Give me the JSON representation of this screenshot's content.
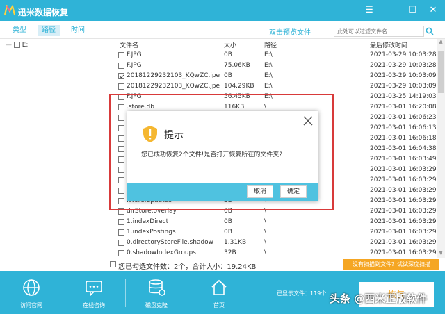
{
  "app": {
    "title": "迅米数据恢复"
  },
  "window_controls": {
    "menu": "☰",
    "minimize": "—",
    "maximize": "☐",
    "close": "✕"
  },
  "tabs": [
    {
      "label": "类型"
    },
    {
      "label": "路径"
    },
    {
      "label": "时间"
    }
  ],
  "toolbar": {
    "preview_link": "双击预览文件",
    "search_placeholder": "此处可以过滤文件名"
  },
  "tree": {
    "root_label": "E:"
  },
  "table": {
    "headers": {
      "name": "文件名",
      "size": "大小",
      "path": "路径",
      "mtime": "最后修改时间"
    },
    "rows": [
      {
        "checked": false,
        "name": "F.JPG",
        "size": "0B",
        "path": "E:\\",
        "mtime": "2021-03-29 10:03:28"
      },
      {
        "checked": false,
        "name": "F.JPG",
        "size": "75.06KB",
        "path": "E:\\",
        "mtime": "2021-03-29 10:03:28"
      },
      {
        "checked": true,
        "name": "20181229232103_KQwZC.jpeg",
        "size": "0B",
        "path": "E:\\",
        "mtime": "2021-03-29 10:03:09"
      },
      {
        "checked": false,
        "name": "20181229232103_KQwZC.jpeg",
        "size": "104.29KB",
        "path": "E:\\",
        "mtime": "2021-03-29 10:03:09"
      },
      {
        "checked": false,
        "name": "F.JPG",
        "size": "56.45KB",
        "path": "E:\\",
        "mtime": "2021-03-25 14:19:03"
      },
      {
        "checked": false,
        "name": ".store.db",
        "size": "116KB",
        "path": "\\",
        "mtime": "2021-03-01 16:20:08"
      },
      {
        "checked": false,
        "name": "",
        "size": "",
        "path": "",
        "mtime": "2021-03-01 16:06:23"
      },
      {
        "checked": false,
        "name": "",
        "size": "",
        "path": "",
        "mtime": "2021-03-01 16:06:13"
      },
      {
        "checked": false,
        "name": "",
        "size": "",
        "path": "",
        "mtime": "2021-03-01 16:06:18"
      },
      {
        "checked": false,
        "name": "",
        "size": "",
        "path": "",
        "mtime": "2021-03-01 16:04:38"
      },
      {
        "checked": false,
        "name": "",
        "size": "",
        "path": "",
        "mtime": "2021-03-01 16:03:49"
      },
      {
        "checked": false,
        "name": "",
        "size": "",
        "path": "",
        "mtime": "2021-03-01 16:03:29"
      },
      {
        "checked": false,
        "name": "",
        "size": "",
        "path": "",
        "mtime": "2021-03-01 16:03:29"
      },
      {
        "checked": false,
        "name": "",
        "size": "",
        "path": "",
        "mtime": "2021-03-01 16:03:29"
      },
      {
        "checked": false,
        "name": ".store.updates",
        "size": "3B",
        "path": "\\",
        "mtime": "2021-03-01 16:03:29"
      },
      {
        "checked": false,
        "name": "dirStore.overlay",
        "size": "0B",
        "path": "\\",
        "mtime": "2021-03-01 16:03:29"
      },
      {
        "checked": false,
        "name": "1.indexDirect",
        "size": "0B",
        "path": "\\",
        "mtime": "2021-03-01 16:03:29"
      },
      {
        "checked": false,
        "name": "1.indexPostings",
        "size": "0B",
        "path": "\\",
        "mtime": "2021-03-01 16:03:29"
      },
      {
        "checked": false,
        "name": "0.directoryStoreFile.shadow",
        "size": "1.31KB",
        "path": "\\",
        "mtime": "2021-03-01 16:03:29"
      },
      {
        "checked": false,
        "name": "0.shadowIndexGroups",
        "size": "32B",
        "path": "\\",
        "mtime": "2021-03-01 16:03:29"
      }
    ]
  },
  "status": {
    "selected_text": "您已勾选文件数：2个，合计大小：19.24KB",
    "deep_scan": "没有扫描到文件？试试深度扫描"
  },
  "bottom_nav": [
    {
      "label": "访问官网"
    },
    {
      "label": "在线咨询"
    },
    {
      "label": "磁盘克隆"
    },
    {
      "label": "首页"
    }
  ],
  "bottom": {
    "shown_count": "已显示文件：119个",
    "recover_label": "恢复"
  },
  "watermark": "头条 @西米正版软件",
  "dialog": {
    "title": "提示",
    "message": "您已成功恢复2个文件!是否打开恢复所在的文件夹?",
    "cancel": "取消",
    "ok": "确定"
  },
  "colors": {
    "accent": "#2fb3d7",
    "warning": "#f5a623",
    "highlight": "#d83a3a"
  }
}
